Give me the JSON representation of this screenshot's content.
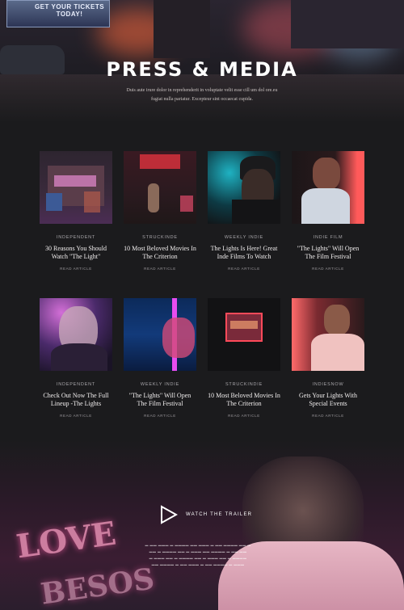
{
  "hero": {
    "title": "PRESS & MEDIA",
    "subtitle": "Duis aute irure dolor in reprehenderit in voluptate velit esse cill um dol ore.eu fugiat nulla pariatur. Excepteur sint occaecat cupida.",
    "sign_text": "GET YOUR TICKETS TODAY!"
  },
  "articles": [
    {
      "category": "Independent",
      "title": "30 Reasons You Should Watch \"The Light\"",
      "read": "Read Article"
    },
    {
      "category": "Struckinde",
      "title": "10 Most Beloved Movies In The Criterion",
      "read": "Read Article"
    },
    {
      "category": "Weekly Indie",
      "title": "The Lights Is Here! Great Inde Films To Watch",
      "read": "Read Article"
    },
    {
      "category": "Indie Film",
      "title": "\"The Lights\" Will Open The Film Festival",
      "read": "Read Article"
    },
    {
      "category": "Independent",
      "title": "Check Out Now The Full Lineup -The Lights",
      "read": "Read Article"
    },
    {
      "category": "Weekly Indie",
      "title": "\"The Lights\" Will Open The Film Festival",
      "read": "Read Article"
    },
    {
      "category": "Struckindie",
      "title": "10 Most Beloved Movies In The Criterion",
      "read": "Read Article"
    },
    {
      "category": "Indiesnow",
      "title": "Gets Your Lights With Special Events",
      "read": "Read Article"
    }
  ],
  "trailer": {
    "label": "Watch The Trailer",
    "neon_1": "LOVE",
    "neon_2": "BESOS"
  },
  "colors": {
    "background": "#1b1b1d",
    "text": "#f1eeee",
    "muted": "#a8a6aa"
  }
}
